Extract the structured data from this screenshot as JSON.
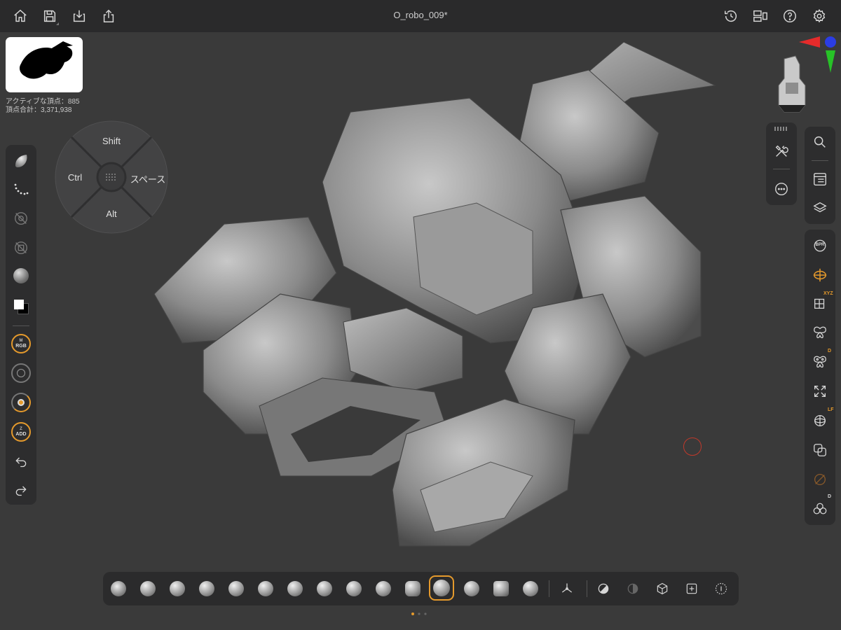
{
  "header": {
    "title": "O_robo_009*",
    "left_icons": [
      "home-icon",
      "save-icon",
      "import-icon",
      "export-icon"
    ],
    "right_icons": [
      "history-icon",
      "layout-icon",
      "help-icon",
      "settings-icon"
    ]
  },
  "stats": {
    "active_vertices": "アクティブな頂点：885",
    "total_vertices": "頂点合計：3,371,938"
  },
  "modifier_wheel": {
    "top": "Shift",
    "left": "Ctrl",
    "right": "スペース",
    "bottom": "Alt"
  },
  "left_toolbar": {
    "rgb_label": "RGB",
    "rgb_prefix": "M",
    "add_prefix": "Z",
    "add_label": "ADD"
  },
  "right_toolbar": {
    "xyz_badge": "XYZ",
    "d_badge": "D",
    "lf_badge": "LF",
    "d2_badge": "D",
    "bpr_label": "BPR"
  },
  "brushes": [
    "clay-buildup-brush",
    "dam-standard-brush",
    "move-brush",
    "standard-brush",
    "inflate-brush",
    "smooth-brush",
    "snakehook-brush",
    "pinch-brush",
    "trim-brush",
    "flatten-brush",
    "curve-brush",
    "hpolish-brush",
    "mask-brush",
    "chisel-brush",
    "spiral-brush"
  ],
  "accent_color": "#e59a2c",
  "brush_cursor_color": "#c0392b",
  "gizmo_colors": {
    "x": "#e52b2b",
    "y": "#27c227",
    "z": "#2b3de5"
  }
}
